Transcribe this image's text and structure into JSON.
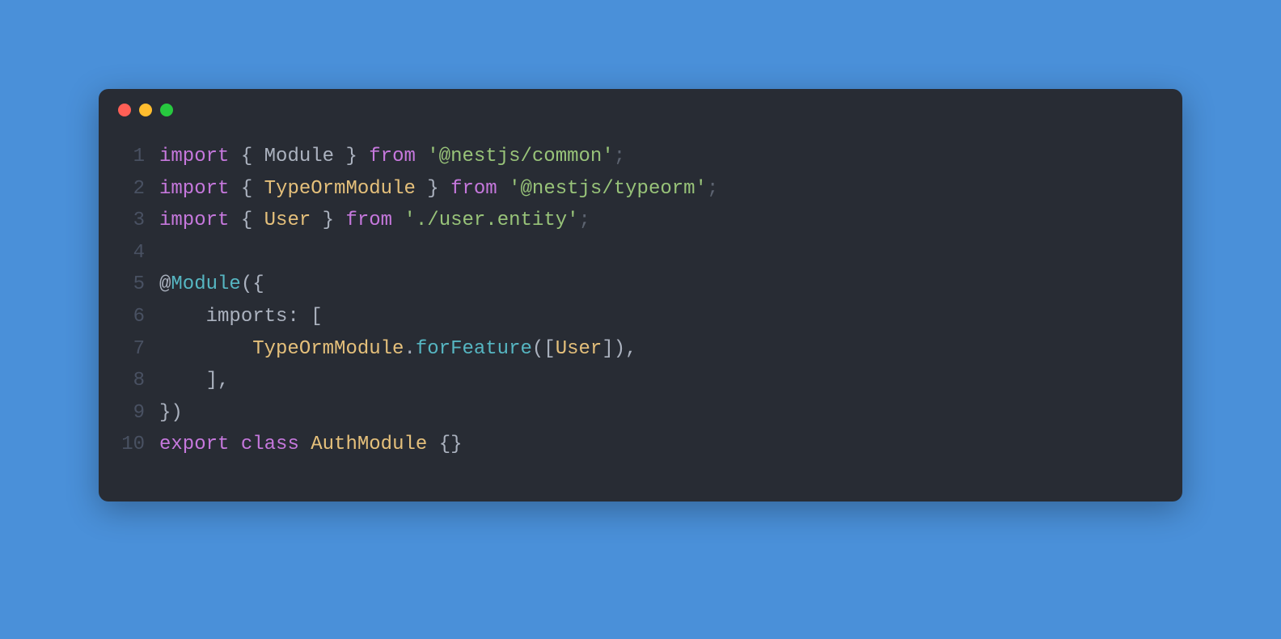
{
  "window": {
    "traffic_lights": [
      "close",
      "minimize",
      "maximize"
    ]
  },
  "code": {
    "lines": [
      {
        "num": "1",
        "tokens": [
          {
            "t": "import",
            "c": "tok-keyword"
          },
          {
            "t": " ",
            "c": "tok-plain"
          },
          {
            "t": "{",
            "c": "tok-punct"
          },
          {
            "t": " Module ",
            "c": "tok-plain"
          },
          {
            "t": "}",
            "c": "tok-punct"
          },
          {
            "t": " ",
            "c": "tok-plain"
          },
          {
            "t": "from",
            "c": "tok-keyword"
          },
          {
            "t": " ",
            "c": "tok-plain"
          },
          {
            "t": "'@nestjs/common'",
            "c": "tok-string"
          },
          {
            "t": ";",
            "c": "tok-dim"
          }
        ]
      },
      {
        "num": "2",
        "tokens": [
          {
            "t": "import",
            "c": "tok-keyword"
          },
          {
            "t": " ",
            "c": "tok-plain"
          },
          {
            "t": "{",
            "c": "tok-punct"
          },
          {
            "t": " ",
            "c": "tok-plain"
          },
          {
            "t": "TypeOrmModule",
            "c": "tok-class"
          },
          {
            "t": " ",
            "c": "tok-plain"
          },
          {
            "t": "}",
            "c": "tok-punct"
          },
          {
            "t": " ",
            "c": "tok-plain"
          },
          {
            "t": "from",
            "c": "tok-keyword"
          },
          {
            "t": " ",
            "c": "tok-plain"
          },
          {
            "t": "'@nestjs/typeorm'",
            "c": "tok-string"
          },
          {
            "t": ";",
            "c": "tok-dim"
          }
        ]
      },
      {
        "num": "3",
        "tokens": [
          {
            "t": "import",
            "c": "tok-keyword"
          },
          {
            "t": " ",
            "c": "tok-plain"
          },
          {
            "t": "{",
            "c": "tok-punct"
          },
          {
            "t": " ",
            "c": "tok-plain"
          },
          {
            "t": "User",
            "c": "tok-class"
          },
          {
            "t": " ",
            "c": "tok-plain"
          },
          {
            "t": "}",
            "c": "tok-punct"
          },
          {
            "t": " ",
            "c": "tok-plain"
          },
          {
            "t": "from",
            "c": "tok-keyword"
          },
          {
            "t": " ",
            "c": "tok-plain"
          },
          {
            "t": "'./user.entity'",
            "c": "tok-string"
          },
          {
            "t": ";",
            "c": "tok-dim"
          }
        ]
      },
      {
        "num": "4",
        "tokens": []
      },
      {
        "num": "5",
        "tokens": [
          {
            "t": "@",
            "c": "tok-decorator"
          },
          {
            "t": "Module",
            "c": "tok-method"
          },
          {
            "t": "({",
            "c": "tok-punct"
          }
        ]
      },
      {
        "num": "6",
        "tokens": [
          {
            "t": "    imports",
            "c": "tok-property"
          },
          {
            "t": ": [",
            "c": "tok-punct"
          }
        ]
      },
      {
        "num": "7",
        "tokens": [
          {
            "t": "        ",
            "c": "tok-plain"
          },
          {
            "t": "TypeOrmModule",
            "c": "tok-class"
          },
          {
            "t": ".",
            "c": "tok-punct"
          },
          {
            "t": "forFeature",
            "c": "tok-method"
          },
          {
            "t": "([",
            "c": "tok-punct"
          },
          {
            "t": "User",
            "c": "tok-class"
          },
          {
            "t": "]),",
            "c": "tok-punct"
          }
        ]
      },
      {
        "num": "8",
        "tokens": [
          {
            "t": "    ],",
            "c": "tok-punct"
          }
        ]
      },
      {
        "num": "9",
        "tokens": [
          {
            "t": "})",
            "c": "tok-punct"
          }
        ]
      },
      {
        "num": "10",
        "tokens": [
          {
            "t": "export",
            "c": "tok-keyword"
          },
          {
            "t": " ",
            "c": "tok-plain"
          },
          {
            "t": "class",
            "c": "tok-keyword"
          },
          {
            "t": " ",
            "c": "tok-plain"
          },
          {
            "t": "AuthModule",
            "c": "tok-class"
          },
          {
            "t": " ",
            "c": "tok-plain"
          },
          {
            "t": "{}",
            "c": "tok-punct"
          }
        ]
      }
    ]
  }
}
